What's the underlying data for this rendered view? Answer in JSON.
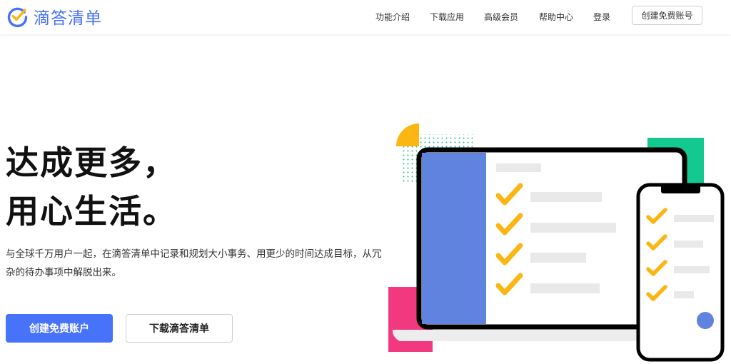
{
  "header": {
    "logo_text": "滴答清单",
    "nav": [
      {
        "label": "功能介绍"
      },
      {
        "label": "下载应用"
      },
      {
        "label": "高级会员"
      },
      {
        "label": "帮助中心"
      },
      {
        "label": "登录"
      }
    ],
    "signup_label": "创建免费账号"
  },
  "hero": {
    "headline_line1": "达成更多，",
    "headline_line2": "用心生活。",
    "description": "与全球千万用户一起，在滴答清单中记录和规划大小事务、用更少的时间达成目标，从冗杂的待办事项中解脱出来。",
    "primary_button": "创建免费账户",
    "secondary_button": "下载滴答清单"
  },
  "colors": {
    "brand": "#4772fa",
    "checkmark": "#fcb614",
    "laptop_sidebar": "#6183e0",
    "green_block": "#14c98f",
    "pink_block": "#f2387f",
    "dots": "#1fbf87"
  },
  "icons": {
    "logo": "checkmark-circle-icon",
    "task_check": "checkmark-icon",
    "fab": "circle-button-icon"
  }
}
